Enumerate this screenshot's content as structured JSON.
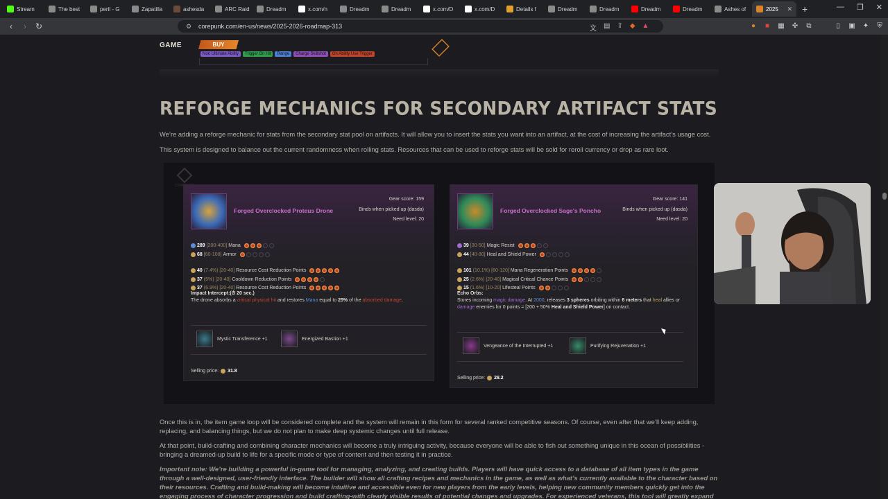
{
  "browser": {
    "tabs": [
      {
        "label": "Stream",
        "color": "#53fc18"
      },
      {
        "label": "The best",
        "color": "#8a8a8a"
      },
      {
        "label": "peril - G",
        "color": "#8a8a8a"
      },
      {
        "label": "Zapatilla",
        "color": "#8a8a8a"
      },
      {
        "label": "ashesda",
        "color": "#6a4a3a"
      },
      {
        "label": "ARC Raid",
        "color": "#8a8a8a"
      },
      {
        "label": "Dreadm",
        "color": "#8a8a8a"
      },
      {
        "label": "x.com/n",
        "color": "#ffffff"
      },
      {
        "label": "Dreadm",
        "color": "#8a8a8a"
      },
      {
        "label": "Dreadm",
        "color": "#8a8a8a"
      },
      {
        "label": "x.com/D",
        "color": "#ffffff"
      },
      {
        "label": "x.com/D",
        "color": "#ffffff"
      },
      {
        "label": "Details f",
        "color": "#e0a030"
      },
      {
        "label": "Dreadm",
        "color": "#8a8a8a"
      },
      {
        "label": "Dreadm",
        "color": "#8a8a8a"
      },
      {
        "label": "Dreadm",
        "color": "#ff0000"
      },
      {
        "label": "Dreadm",
        "color": "#ff0000"
      },
      {
        "label": "Ashes of",
        "color": "#8a8a8a"
      },
      {
        "label": "2025",
        "color": "#d7832b"
      }
    ],
    "active_tab_close": "✕",
    "new_tab": "+",
    "url": "corepunk.com/en-us/news/2025-2026-roadmap-313",
    "window_controls": [
      "—",
      "❐",
      "✕"
    ]
  },
  "site": {
    "nav_game": "GAME",
    "buy_label": "BUY",
    "tags": [
      {
        "label": "Non Ultimate Ability",
        "color": "#7c5ac8"
      },
      {
        "label": "Trigger On Hit",
        "color": "#2f9e4c"
      },
      {
        "label": "Range",
        "color": "#4d7fd0"
      },
      {
        "label": "Charge Skillshot",
        "color": "#8e4fb6"
      },
      {
        "label": "On Ability Use Trigger",
        "color": "#c0442c"
      }
    ]
  },
  "article": {
    "heading": "REFORGE MECHANICS FOR SECONDARY ARTIFACT STATS",
    "para1": "We’re adding a reforge mechanic for stats from the secondary stat pool on artifacts. It will allow you to insert the stats you want into an artifact, at the cost of increasing the artifact’s usage cost.",
    "para2": "This system is designed to balance out the current randomness when rolling stats. Resources that can be used to reforge stats will be sold for reroll currency or drop as rare loot.",
    "para3": "Once this is in, the item game loop will be considered complete and the system will remain in this form for several ranked competitive seasons. Of course, even after that we’ll keep adding, replacing, and balancing things, but we do not plan to make deep systemic changes until full release.",
    "para4": "At that point, build-crafting and combining character mechanics will become a truly intriguing activity, because everyone will be able to fish out something unique in this ocean of possibilities - bringing a dreamed-up build to life for a specific mode or type of content and then testing it in practice.",
    "para5": "Important note: We’re building a powerful in-game tool for managing, analyzing, and creating builds. Players will have quick access to a database of all item types in the game through a well-designed, user-friendly interface. The builder will show all crafting recipes and mechanics in the game, as well as what’s currently available to the character based on their resources. Crafting and build-making will become intuitive and accessible even for new players from the early levels, helping new community members quickly get into the engaging process of character progression and build crafting-with clearly visible results of potential changes and upgrades. For experienced veterans, this tool will greatly expand",
    "watermark": "COREPUNK"
  },
  "cards": [
    {
      "name": "Forged Overclocked Proteus Drone",
      "gear_score": "Gear score: 159",
      "binds": "Binds when picked up (dasda)",
      "need_level": "Need level: 20",
      "primary": [
        {
          "value": "289",
          "range": "[200-400]",
          "label": "Mana",
          "filled": 3,
          "total": 5,
          "gem": "#5b8fd6"
        },
        {
          "value": "68",
          "range": "[60-100]",
          "label": "Armor",
          "filled": 1,
          "total": 5,
          "gem": "#c7a35b"
        }
      ],
      "secondary": [
        {
          "value": "40",
          "range": "(7.4%) [20-40]",
          "label": "Resource Cost Reduction Points",
          "filled": 5,
          "total": 5
        },
        {
          "value": "37",
          "range": "(5%) [20-40]",
          "label": "Cooldown Reduction Points",
          "filled": 4,
          "total": 4
        },
        {
          "value": "37",
          "range": "(6.9%) [20-40]",
          "label": "Resource Cost Reduction Points",
          "filled": 5,
          "total": 5
        }
      ],
      "ability": {
        "title": "Impact Intercept:",
        "cooldown": "(⏱ 20 sec.)",
        "t1": "The drone absorbs a ",
        "h1": "critical physical hit",
        "t2": " and restores ",
        "h2": "Mana",
        "t3": " equal to ",
        "b1": "25%",
        "t4": " of the ",
        "h3": "absorbed damage",
        "t5": "."
      },
      "runes": [
        {
          "label": "Mystic Transference +1",
          "color": "#3a7a8a"
        },
        {
          "label": "Energized Bastion +1",
          "color": "#7a4a8a"
        }
      ],
      "selling_label": "Selling price:",
      "selling_value": "31.8"
    },
    {
      "name": "Forged Overclocked Sage's Poncho",
      "gear_score": "Gear score: 141",
      "binds": "Binds when picked up (dasda)",
      "need_level": "Need level: 20",
      "primary": [
        {
          "value": "39",
          "range": "[30-50]",
          "label": "Magic Resist",
          "filled": 3,
          "total": 5,
          "gem": "#a06bd0"
        },
        {
          "value": "44",
          "range": "[40-80]",
          "label": "Heal and Shield Power",
          "filled": 1,
          "total": 5,
          "gem": "#c7a35b"
        }
      ],
      "secondary": [
        {
          "value": "101",
          "range": "(10.1%) [60-120]",
          "label": "Mana Regeneration Points",
          "filled": 4,
          "total": 5
        },
        {
          "value": "25",
          "range": "(2.6%) [20-40]",
          "label": "Magical Critical Chance Points",
          "filled": 2,
          "total": 5
        },
        {
          "value": "15",
          "range": "(1.6%) [10-20]",
          "label": "Lifesteal Points",
          "filled": 2,
          "total": 5
        }
      ],
      "ability": {
        "title": "Echo Orbs:",
        "t1": "Stores incoming ",
        "h1": "magic damage",
        "t2": ". At ",
        "h2": "2000",
        "t3": ", releases ",
        "b1": "3 spheres",
        "t4": " orbiting within ",
        "b2": "6 meters",
        "t5": " that ",
        "h3": "heal",
        "t6": " allies or ",
        "h4": "damage",
        "t7": " enemies for 0 points = [200 + 50% ",
        "b3": "Heal and Shield Power",
        "t8": "] on contact."
      },
      "runes": [
        {
          "label": "Vengeance of the Interrupted +1",
          "color": "#8a3a8a"
        },
        {
          "label": "Purifying Rejuvenation +1",
          "color": "#3a8a6a"
        }
      ],
      "selling_label": "Selling price:",
      "selling_value": "28.2"
    }
  ]
}
